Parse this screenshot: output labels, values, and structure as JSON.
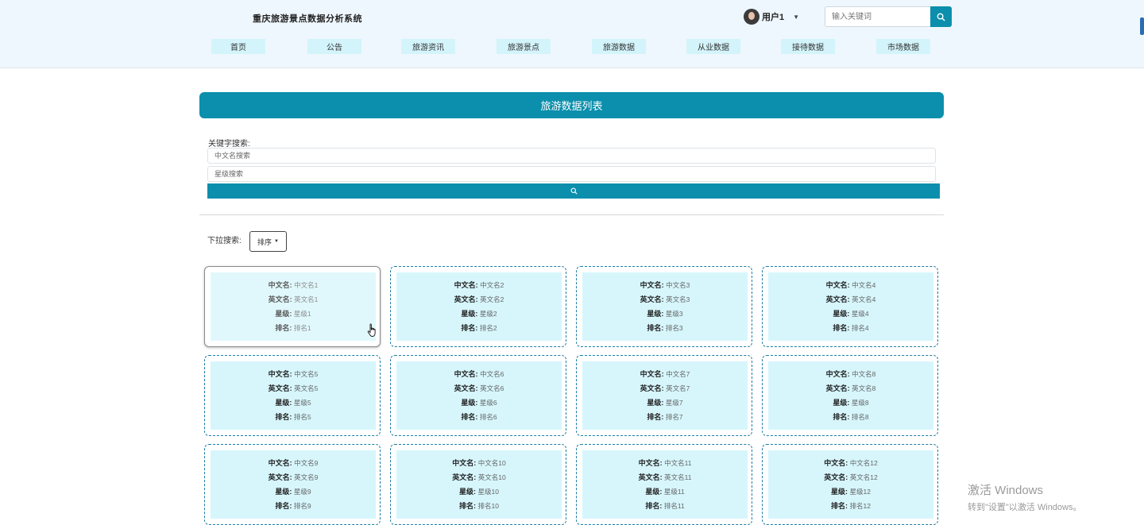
{
  "header": {
    "site_title": "重庆旅游景点数据分析系统",
    "user_name": "用户1",
    "search_placeholder": "输入关键词",
    "search_icon": "search-icon",
    "nav": [
      {
        "label": "首页"
      },
      {
        "label": "公告"
      },
      {
        "label": "旅游资讯"
      },
      {
        "label": "旅游景点"
      },
      {
        "label": "旅游数据"
      },
      {
        "label": "从业数据"
      },
      {
        "label": "接待数据"
      },
      {
        "label": "市场数据"
      }
    ]
  },
  "main": {
    "banner_title": "旅游数据列表",
    "keyword_label": "关键字搜索:",
    "cn_placeholder": "中文名搜索",
    "star_placeholder": "星级搜索",
    "dropdown_label": "下拉搜索:",
    "sort_label": "排序"
  },
  "card_labels": {
    "cn": "中文名:",
    "en": "英文名:",
    "star": "星级:",
    "rank": "排名:"
  },
  "cards": [
    {
      "cn": "中文名1",
      "en": "英文名1",
      "star": "星级1",
      "rank": "排名1"
    },
    {
      "cn": "中文名2",
      "en": "英文名2",
      "star": "星级2",
      "rank": "排名2"
    },
    {
      "cn": "中文名3",
      "en": "英文名3",
      "star": "星级3",
      "rank": "排名3"
    },
    {
      "cn": "中文名4",
      "en": "英文名4",
      "star": "星级4",
      "rank": "排名4"
    },
    {
      "cn": "中文名5",
      "en": "英文名5",
      "star": "星级5",
      "rank": "排名5"
    },
    {
      "cn": "中文名6",
      "en": "英文名6",
      "star": "星级6",
      "rank": "排名6"
    },
    {
      "cn": "中文名7",
      "en": "英文名7",
      "star": "星级7",
      "rank": "排名7"
    },
    {
      "cn": "中文名8",
      "en": "英文名8",
      "star": "星级8",
      "rank": "排名8"
    },
    {
      "cn": "中文名9",
      "en": "英文名9",
      "star": "星级9",
      "rank": "排名9"
    },
    {
      "cn": "中文名10",
      "en": "英文名10",
      "star": "星级10",
      "rank": "排名10"
    },
    {
      "cn": "中文名11",
      "en": "英文名11",
      "star": "星级11",
      "rank": "排名11"
    },
    {
      "cn": "中文名12",
      "en": "英文名12",
      "star": "星级12",
      "rank": "排名12"
    }
  ],
  "watermark": {
    "line1": "激活 Windows",
    "line2": "转到\"设置\"以激活 Windows。"
  },
  "colors": {
    "accent": "#0b8fac",
    "nav_bg": "#d3f4fb",
    "card_bg": "#d6f6fc",
    "header_bg": "#eef7fd"
  }
}
